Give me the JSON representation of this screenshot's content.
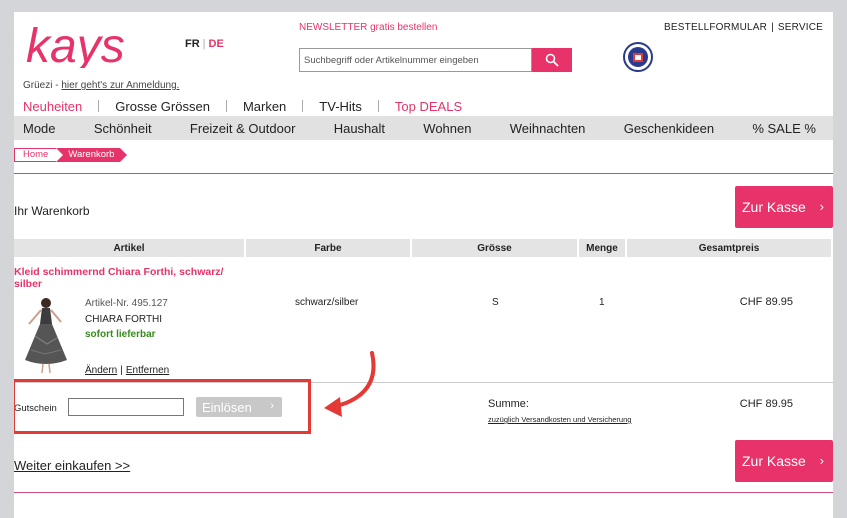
{
  "header": {
    "logo_text": "kays",
    "lang_fr": "FR",
    "lang_de": "DE",
    "newsletter": "NEWSLETTER gratis bestellen",
    "search_placeholder": "Suchbegriff oder Artikelnummer eingeben",
    "top_link_1": "BESTELLFORMULAR",
    "top_link_2": "SERVICE",
    "greet_prefix": "Grüezi - ",
    "greet_link": "hier geht's zur Anmeldung."
  },
  "nav_primary": [
    {
      "label": "Neuheiten",
      "color": "#e6336a"
    },
    {
      "label": "Grosse Grössen",
      "color": "#222222"
    },
    {
      "label": "Marken",
      "color": "#222222"
    },
    {
      "label": "TV-Hits",
      "color": "#222222"
    },
    {
      "label": "Top DEALS",
      "color": "#e6336a"
    }
  ],
  "nav_secondary": [
    "Mode",
    "Schönheit",
    "Freizeit & Outdoor",
    "Haushalt",
    "Wohnen",
    "Weihnachten",
    "Geschenkideen",
    "% SALE %"
  ],
  "breadcrumb": {
    "home": "Home",
    "current": "Warenkorb"
  },
  "cart": {
    "title": "Ihr Warenkorb",
    "checkout_label": "Zur Kasse",
    "columns": [
      "Artikel",
      "Farbe",
      "Grösse",
      "Menge",
      "Gesamtpreis"
    ],
    "item": {
      "name": "Kleid schimmernd Chiara Forthi, schwarz/ silber",
      "article_no": "Artikel-Nr. 495.127",
      "brand": "CHIARA FORTHI",
      "availability": "sofort lieferbar",
      "color": "schwarz/silber",
      "size": "S",
      "quantity": "1",
      "price": "CHF 89.95",
      "edit_label": "Ändern",
      "remove_label": "Entfernen"
    },
    "voucher_label": "Gutschein",
    "voucher_value": "",
    "redeem_label": "Einlösen",
    "sum_label": "Summe:",
    "shipping_note": "zuzüglich Versandkosten und Versicherung",
    "sum_price": "CHF 89.95",
    "continue_label": "Weiter einkaufen >>"
  },
  "colors": {
    "brand_pink": "#e8336a",
    "annotation_red": "#e53935",
    "in_stock_green": "#3a8a1f"
  }
}
